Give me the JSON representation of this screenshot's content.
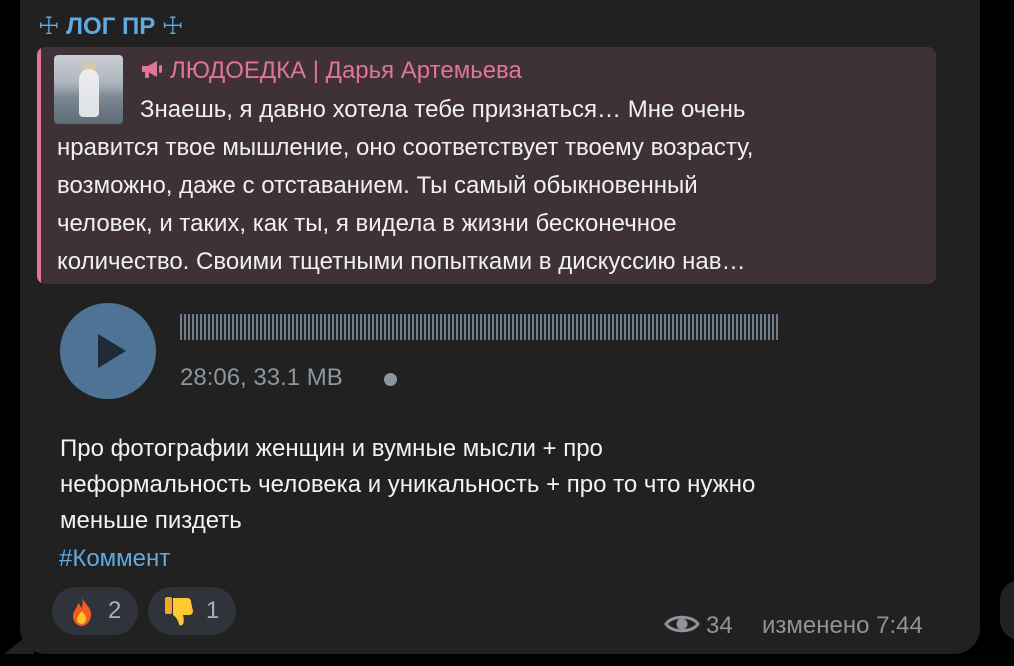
{
  "post": {
    "channel_title": "☩ ЛОГ ПР ☩",
    "quote": {
      "author": "ЛЮДОЕДКА | Дарья Артемьева",
      "lines": [
        "Знаешь, я давно хотела тебе признаться… Мне очень",
        "нравится твое мышление, оно соответствует твоему возрасту,",
        "возможно, даже с отставанием. Ты самый обыкновенный",
        "человек, и таких, как ты, я видела в жизни бесконечное",
        "количество. Своими тщетными попытками в дискуссию нав…"
      ],
      "accent_color": "#e1749b"
    },
    "audio": {
      "meta": "28:06, 33.1 MB",
      "play_icon": "play-icon"
    },
    "text_lines": [
      "Про фотографии женщин и вумные мысли + про",
      "неформальность человека и уникальность + про то что нужно",
      "меньше пиздеть"
    ],
    "hashtag": "#Коммент",
    "reactions": [
      {
        "icon": "fire-icon",
        "count": "2"
      },
      {
        "icon": "thumbs-down-icon",
        "count": "1"
      }
    ],
    "views": "34",
    "edited_time": "изменено 7:44"
  },
  "colors": {
    "background": "#000000",
    "bubble": "#212121",
    "link": "#62a9e0",
    "meta": "#8e949a"
  }
}
